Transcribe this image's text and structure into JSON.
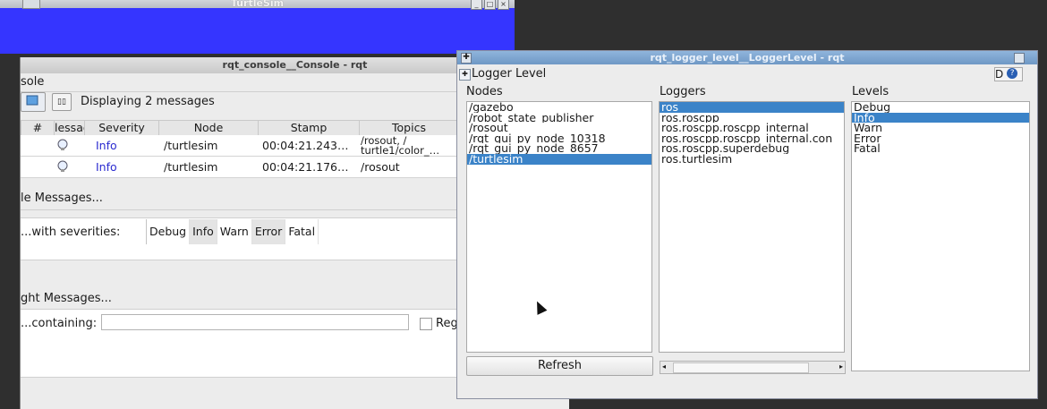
{
  "turtlesim": {
    "title": "TurtleSim"
  },
  "console": {
    "title": "rqt_console__Console - rqt",
    "menu_fragment": "sole",
    "status": "Displaying 2 messages",
    "columns": [
      "#",
      "lessag",
      "Severity",
      "Node",
      "Stamp",
      "Topics"
    ],
    "rows": [
      {
        "severity": "Info",
        "node": "/turtlesim",
        "stamp": "00:04:21.243…",
        "topics_line1": "/rosout, /",
        "topics_line2": "turtle1/color_…"
      },
      {
        "severity": "Info",
        "node": "/turtlesim",
        "stamp": "00:04:21.176…",
        "topics_line1": "/rosout",
        "topics_line2": ""
      }
    ],
    "exclude_label": "le Messages...",
    "severities_label": "...with severities:",
    "severity_tokens": [
      "Debug",
      "Info",
      "Warn",
      "Error",
      "Fatal"
    ],
    "highlight_label": "ght Messages...",
    "containing_label": "...containing:",
    "containing_value": "",
    "regex_label": "Reg"
  },
  "logger": {
    "title": "rqt_logger_level__LoggerLevel - rqt",
    "plugin_label": "Logger Level",
    "nodes_label": "Nodes",
    "loggers_label": "Loggers",
    "levels_label": "Levels",
    "nodes": [
      "/gazebo",
      "/robot_state_publisher",
      "/rosout",
      "/rqt_gui_py_node_10318",
      "/rqt_gui_py_node_8657",
      "/turtlesim"
    ],
    "loggers": [
      "ros",
      "ros.roscpp",
      "ros.roscpp.roscpp_internal",
      "ros.roscpp.roscpp_internal.con",
      "ros.roscpp.superdebug",
      "ros.turtlesim"
    ],
    "levels": [
      "Debug",
      "Info",
      "Warn",
      "Error",
      "Fatal"
    ],
    "selected_node": "/turtlesim",
    "selected_logger": "ros",
    "selected_level": "Info",
    "refresh_label": "Refresh",
    "d_label": "D"
  }
}
